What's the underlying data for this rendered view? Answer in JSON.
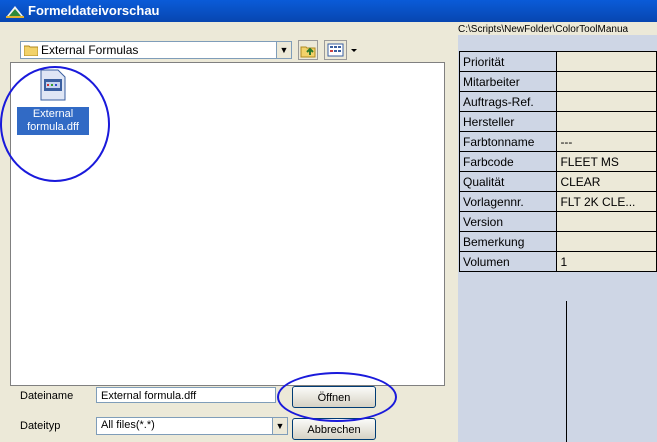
{
  "window": {
    "title": "Formeldateivorschau"
  },
  "toolbar": {
    "folder": "External Formulas"
  },
  "files": [
    {
      "name": "External formula.dff"
    }
  ],
  "form": {
    "filename_label": "Dateiname",
    "filename_value": "External formula.dff",
    "filetype_label": "Dateityp",
    "filetype_value": "All files(*.*)",
    "open_label": "Öffnen",
    "cancel_label": "Abbrechen"
  },
  "details": {
    "path": "C:\\Scripts\\NewFolder\\ColorToolManua",
    "rows": [
      {
        "key": "Priorität",
        "value": ""
      },
      {
        "key": "Mitarbeiter",
        "value": ""
      },
      {
        "key": "Auftrags-Ref.",
        "value": ""
      },
      {
        "key": "Hersteller",
        "value": ""
      },
      {
        "key": "Farbtonname",
        "value": "---"
      },
      {
        "key": "Farbcode",
        "value": "FLEET MS"
      },
      {
        "key": "Qualität",
        "value": "CLEAR"
      },
      {
        "key": "Vorlagennr.",
        "value": "FLT 2K CLE..."
      },
      {
        "key": "Version",
        "value": ""
      },
      {
        "key": "Bemerkung",
        "value": ""
      },
      {
        "key": "Volumen",
        "value": "1"
      }
    ]
  },
  "icons": [
    "app-icon",
    "folder-icon",
    "folder-up-icon",
    "view-menu-icon",
    "formula-file-icon",
    "chevron-down-icon"
  ],
  "colors": {
    "titlebar": "#0a5bd8",
    "selection": "#316ac5",
    "annotation_circle": "#1a1adb"
  }
}
